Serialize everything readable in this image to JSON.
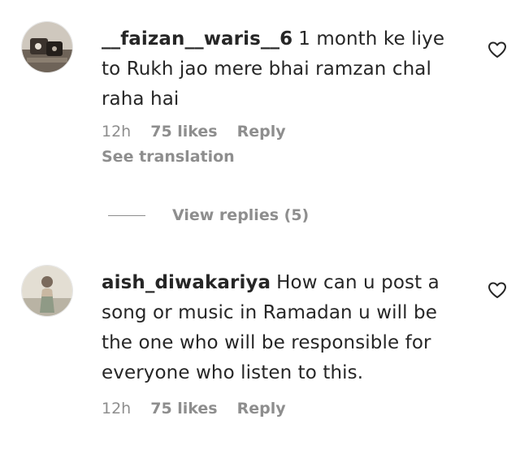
{
  "comments": [
    {
      "username": "__faizan__waris__6",
      "text": "1 month ke liye to Rukh jao mere bhai ramzan chal raha hai",
      "time": "12h",
      "likes": "75 likes",
      "reply": "Reply",
      "translation": "See translation",
      "avatar_icon": "user-photo",
      "like_icon": "heart-outline-icon"
    },
    {
      "username": "aish_diwakariya",
      "text": "How can u post a song or music in Ramadan u will be the one who will be responsible for everyone who listen to this.",
      "time": "12h",
      "likes": "75 likes",
      "reply": "Reply",
      "avatar_icon": "user-photo",
      "like_icon": "heart-outline-icon"
    }
  ],
  "replies_toggle": {
    "label": "View replies (5)"
  }
}
